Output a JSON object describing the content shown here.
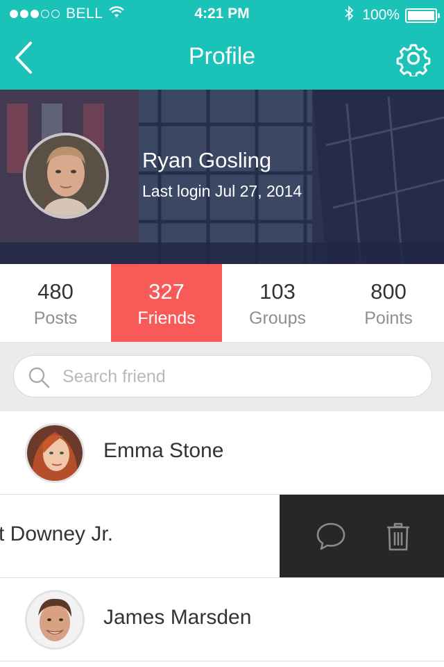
{
  "status_bar": {
    "carrier": "BELL",
    "time": "4:21 PM",
    "battery": "100%",
    "signal_icon": "signal-dots-icon",
    "wifi_icon": "wifi-icon",
    "bluetooth_icon": "bluetooth-icon",
    "battery_icon": "battery-icon",
    "battery_level": 1.0
  },
  "nav": {
    "title": "Profile",
    "back_icon": "chevron-left-icon",
    "settings_icon": "gear-icon"
  },
  "profile": {
    "name": "Ryan Gosling",
    "last_login": "Last login Jul 27, 2014"
  },
  "stats": [
    {
      "value": "480",
      "label": "Posts"
    },
    {
      "value": "327",
      "label": "Friends",
      "active": true
    },
    {
      "value": "103",
      "label": "Groups"
    },
    {
      "value": "800",
      "label": "Points"
    }
  ],
  "search": {
    "placeholder": "Search friend",
    "icon": "search-icon"
  },
  "friends": [
    {
      "name": "Emma Stone"
    },
    {
      "name": "t Downey Jr.",
      "swiped": true,
      "actions": [
        "chat-bubble-icon",
        "trash-icon"
      ]
    },
    {
      "name": "James Marsden"
    }
  ],
  "colors": {
    "teal": "#1bc2b8",
    "coral": "#f85a58",
    "action_bg": "#272727"
  }
}
